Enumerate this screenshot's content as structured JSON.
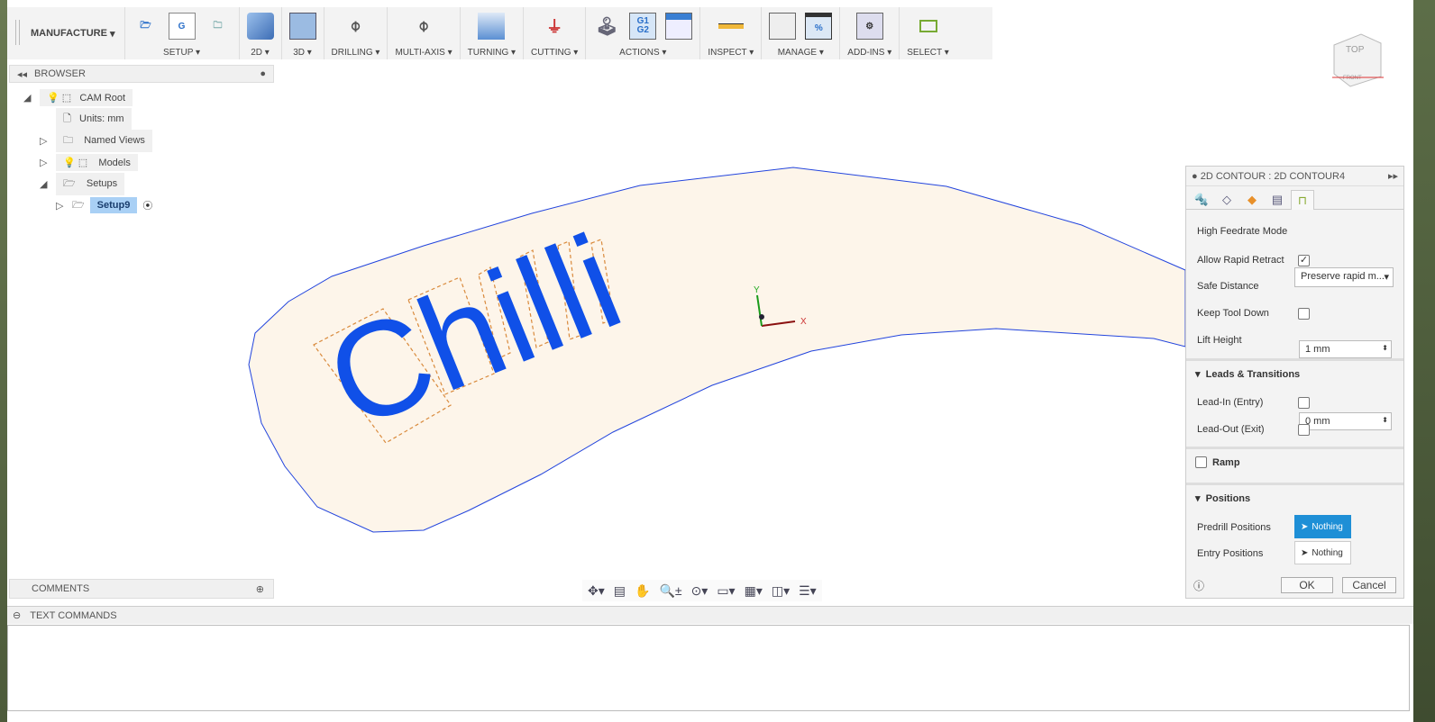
{
  "toolbar": {
    "workspace": "MANUFACTURE",
    "groups": [
      {
        "label": "SETUP",
        "icons": [
          "new-setup-icon",
          "nc-program-icon",
          "setup-folder-icon"
        ]
      },
      {
        "label": "2D",
        "icons": [
          "2d-adaptive-icon"
        ]
      },
      {
        "label": "3D",
        "icons": [
          "3d-adaptive-icon"
        ]
      },
      {
        "label": "DRILLING",
        "icons": [
          "drill-icon"
        ]
      },
      {
        "label": "MULTI-AXIS",
        "icons": [
          "multi-axis-icon"
        ]
      },
      {
        "label": "TURNING",
        "icons": [
          "turning-icon"
        ]
      },
      {
        "label": "CUTTING",
        "icons": [
          "cutting-icon"
        ]
      },
      {
        "label": "ACTIONS",
        "icons": [
          "simulate-icon",
          "post-process-icon",
          "setup-sheet-icon"
        ]
      },
      {
        "label": "INSPECT",
        "icons": [
          "measure-icon"
        ]
      },
      {
        "label": "MANAGE",
        "icons": [
          "tool-library-icon",
          "post-library-icon"
        ]
      },
      {
        "label": "ADD-INS",
        "icons": [
          "scripts-addins-icon"
        ]
      },
      {
        "label": "SELECT",
        "icons": [
          "select-window-icon"
        ]
      }
    ]
  },
  "actions_icon_text": "G1 G2",
  "setup_icon_text": "G",
  "browser": {
    "title": "BROWSER",
    "items": [
      {
        "label": "CAM Root"
      },
      {
        "label": "Units: mm"
      },
      {
        "label": "Named Views"
      },
      {
        "label": "Models"
      },
      {
        "label": "Setups"
      },
      {
        "label": "Setup9"
      }
    ]
  },
  "comments": {
    "title": "COMMENTS"
  },
  "text_commands": {
    "title": "TEXT COMMANDS"
  },
  "viewport": {
    "text": "Chilli",
    "axis_x": "X",
    "axis_y": "Y",
    "viewcube_top": "TOP",
    "viewcube_front": "FRONT",
    "colors": {
      "stock": "#fdf5ea",
      "outline": "#2244dd",
      "toolpath": "#1050e8",
      "boundary": "#d98a3c"
    }
  },
  "panel": {
    "title": "2D CONTOUR : 2D CONTOUR4",
    "high_feedrate_label": "High Feedrate Mode",
    "high_feedrate_value": "Preserve rapid m...",
    "allow_rapid_label": "Allow Rapid Retract",
    "allow_rapid_checked": true,
    "safe_distance_label": "Safe Distance",
    "safe_distance_value": "1 mm",
    "keep_tool_down_label": "Keep Tool Down",
    "keep_tool_down_checked": false,
    "lift_height_label": "Lift Height",
    "lift_height_value": "0 mm",
    "leads_section": "Leads & Transitions",
    "lead_in_label": "Lead-In (Entry)",
    "lead_out_label": "Lead-Out (Exit)",
    "ramp_label": "Ramp",
    "positions_section": "Positions",
    "predrill_label": "Predrill Positions",
    "predrill_value": "Nothing",
    "entry_label": "Entry Positions",
    "entry_value": "Nothing",
    "ok": "OK",
    "cancel": "Cancel",
    "check": "✓"
  }
}
